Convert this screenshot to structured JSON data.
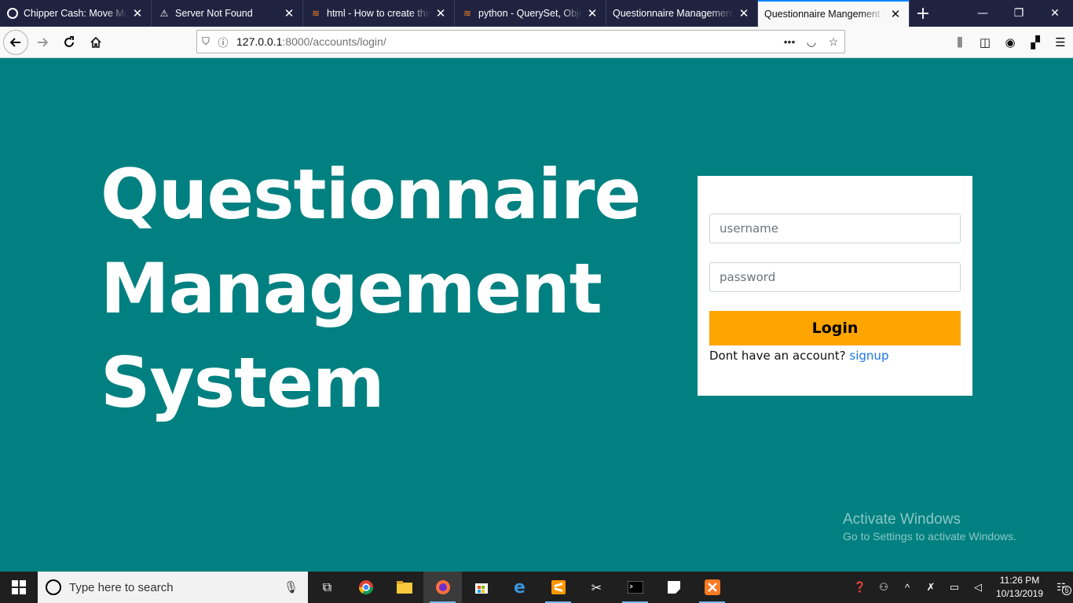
{
  "browser": {
    "tabs": [
      {
        "title": "Chipper Cash: Move Mon",
        "icon": "chipper-icon",
        "active": false
      },
      {
        "title": "Server Not Found",
        "icon": "warning-icon",
        "active": false
      },
      {
        "title": "html - How to create this",
        "icon": "stackoverflow-icon",
        "active": false
      },
      {
        "title": "python - QuerySet, Objec",
        "icon": "stackoverflow-icon",
        "active": false
      },
      {
        "title": "Questionnaire Management",
        "icon": "",
        "active": false
      },
      {
        "title": "Questionnaire Mangement Sy",
        "icon": "",
        "active": true
      }
    ],
    "url_host": "127.0.0.1",
    "url_path": ":8000/accounts/login/"
  },
  "page": {
    "hero_lines": [
      "Questionnaire",
      "Management",
      "System"
    ],
    "login": {
      "username_placeholder": "username",
      "password_placeholder": "password",
      "login_label": "Login",
      "signup_prompt": "Dont have an account? ",
      "signup_link": "signup"
    },
    "background_color": "#008080",
    "button_color": "#ffa500"
  },
  "watermark": {
    "line1": "Activate Windows",
    "line2": "Go to Settings to activate Windows."
  },
  "taskbar": {
    "search_placeholder": "Type here to search",
    "time": "11:26 PM",
    "date": "10/13/2019",
    "notification_count": "5"
  }
}
